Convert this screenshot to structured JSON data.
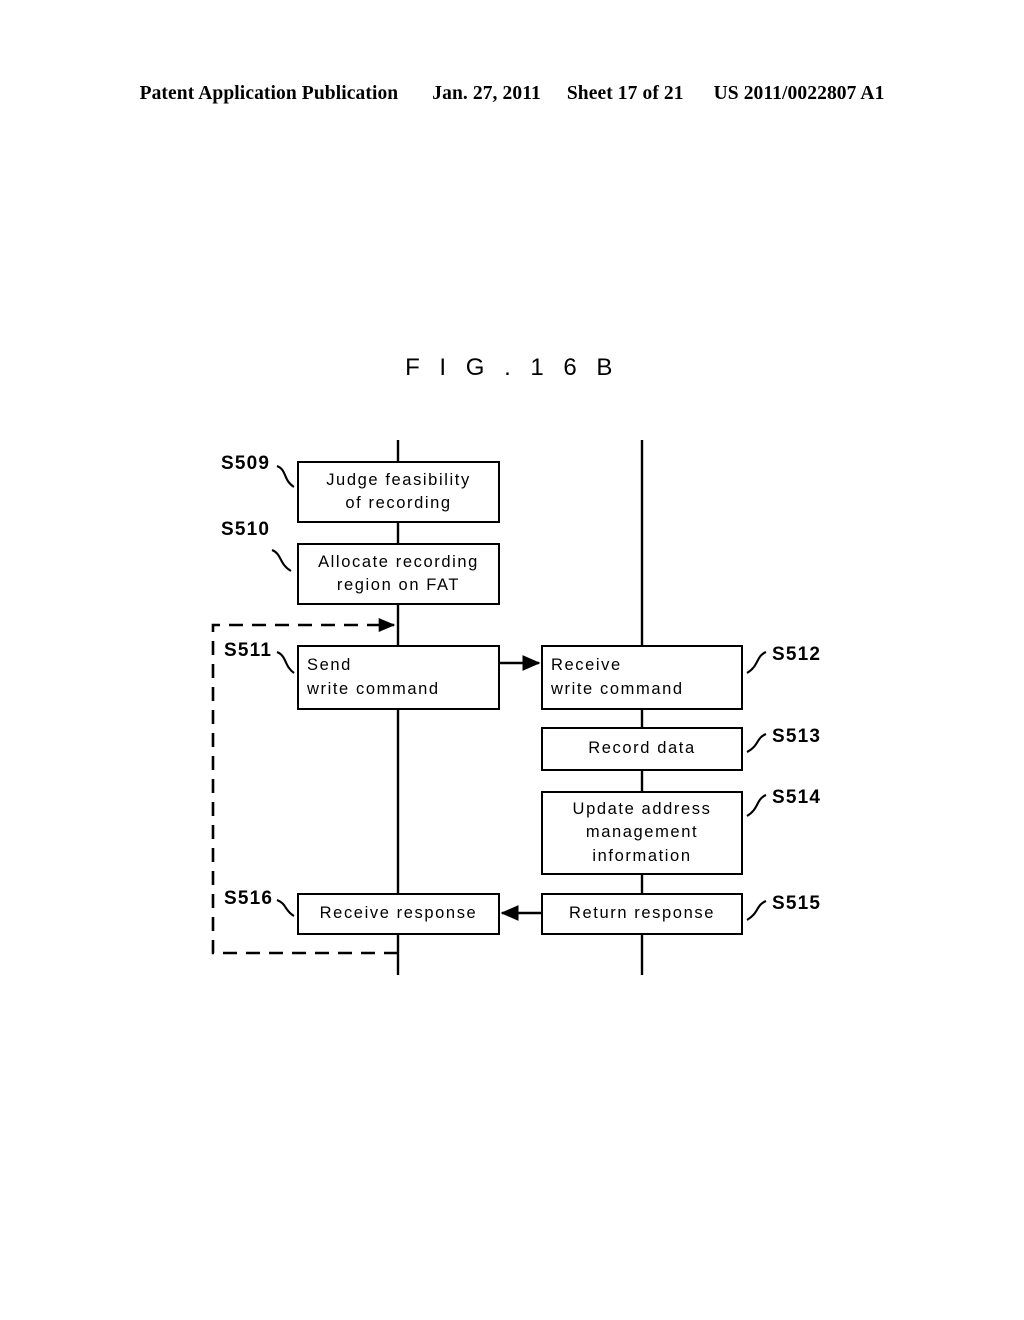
{
  "header": {
    "publication": "Patent Application Publication",
    "date": "Jan. 27, 2011",
    "sheet": "Sheet 17 of 21",
    "docnumber": "US 2011/0022807 A1"
  },
  "figure": {
    "title": "F I G .   1 6 B",
    "ink_color": "#000000",
    "background_color": "#ffffff"
  },
  "flowchart": {
    "steps": [
      {
        "id": "s509",
        "label": "S509",
        "lines": [
          "Judge feasibility",
          "of recording"
        ],
        "column": "left",
        "align": "center"
      },
      {
        "id": "s510",
        "label": "S510",
        "lines": [
          "Allocate recording",
          "region on FAT"
        ],
        "column": "left",
        "align": "center"
      },
      {
        "id": "s511",
        "label": "S511",
        "lines": [
          "Send",
          "write command"
        ],
        "column": "left",
        "align": "left"
      },
      {
        "id": "s512",
        "label": "S512",
        "lines": [
          "Receive",
          "write command"
        ],
        "column": "right",
        "align": "left"
      },
      {
        "id": "s513",
        "label": "S513",
        "lines": [
          "Record data"
        ],
        "column": "right",
        "align": "center"
      },
      {
        "id": "s514",
        "label": "S514",
        "lines": [
          "Update address",
          "management",
          "information"
        ],
        "column": "right",
        "align": "center"
      },
      {
        "id": "s515",
        "label": "S515",
        "lines": [
          "Return response"
        ],
        "column": "right",
        "align": "center"
      },
      {
        "id": "s516",
        "label": "S516",
        "lines": [
          "Receive response"
        ],
        "column": "left",
        "align": "center"
      }
    ],
    "connectors": [
      {
        "name": "send-to-receive-write-command",
        "from": "s511",
        "to": "s512",
        "style": "solid",
        "direction": "right"
      },
      {
        "name": "return-to-receive-response",
        "from": "s515",
        "to": "s516",
        "style": "solid",
        "direction": "left"
      },
      {
        "name": "retry-loop",
        "from": "s516",
        "to": "s511",
        "style": "dashed",
        "direction": "up"
      }
    ],
    "lifelines": [
      {
        "name": "host-lifeline",
        "column": "left"
      },
      {
        "name": "device-lifeline",
        "column": "right"
      }
    ]
  }
}
